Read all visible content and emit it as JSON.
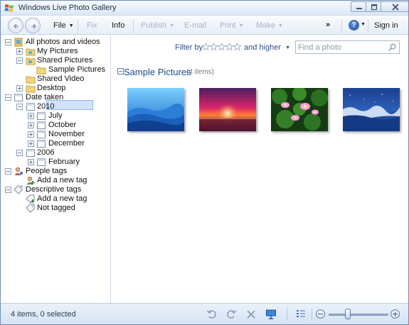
{
  "window": {
    "title": "Windows Live Photo Gallery"
  },
  "toolbar": {
    "items": [
      {
        "label": "File",
        "caret": "▼",
        "enabled": true
      },
      {
        "label": "Fix",
        "caret": "",
        "enabled": false
      },
      {
        "label": "Info",
        "caret": "",
        "enabled": true
      },
      {
        "label": "Publish",
        "caret": "▼",
        "enabled": false
      },
      {
        "label": "E-mail",
        "caret": "",
        "enabled": false
      },
      {
        "label": "Print",
        "caret": "▼",
        "enabled": false
      },
      {
        "label": "Make",
        "caret": "▼",
        "enabled": false
      }
    ],
    "overflow": "»",
    "help": "?",
    "help_caret": "▼",
    "sign_in": "Sign in"
  },
  "tree": {
    "nodes": [
      {
        "label": "All photos and videos",
        "expander": "⊟",
        "icon": "photo-library-icon"
      },
      {
        "label": "My Pictures",
        "expander": "⊞",
        "icon": "folder-icon"
      },
      {
        "label": "Shared Pictures",
        "expander": "⊟",
        "icon": "folder-icon"
      },
      {
        "label": "Sample Pictures",
        "expander": "",
        "icon": "folder-icon",
        "selected": true
      },
      {
        "label": "Shared Video",
        "expander": "",
        "icon": "folder-icon"
      },
      {
        "label": "Desktop",
        "expander": "⊞",
        "icon": "folder-icon"
      },
      {
        "label": "Date taken",
        "expander": "⊟",
        "icon": "calendar-icon"
      },
      {
        "label": "2010",
        "expander": "⊟",
        "icon": "calendar-icon"
      },
      {
        "label": "July",
        "expander": "⊞",
        "icon": "calendar-icon"
      },
      {
        "label": "October",
        "expander": "⊞",
        "icon": "calendar-icon"
      },
      {
        "label": "November",
        "expander": "⊞",
        "icon": "calendar-icon"
      },
      {
        "label": "December",
        "expander": "⊞",
        "icon": "calendar-icon"
      },
      {
        "label": "2006",
        "expander": "⊟",
        "icon": "calendar-icon"
      },
      {
        "label": "February",
        "expander": "⊞",
        "icon": "calendar-icon"
      },
      {
        "label": "People tags",
        "expander": "⊟",
        "icon": "person-tag-icon"
      },
      {
        "label": "Add a new tag",
        "expander": "",
        "icon": "add-person-tag-icon"
      },
      {
        "label": "Descriptive tags",
        "expander": "⊟",
        "icon": "tag-icon"
      },
      {
        "label": "Add a new tag",
        "expander": "",
        "icon": "add-tag-icon"
      },
      {
        "label": "Not tagged",
        "expander": "",
        "icon": "tag-icon"
      }
    ]
  },
  "main": {
    "filter_label": "Filter by",
    "rating_filter": {
      "stars": 5,
      "selected": 0
    },
    "higher_label": "and higher",
    "higher_caret": "▼",
    "search_placeholder": "Find a photo",
    "search_value": "",
    "group": {
      "toggle": "⊟",
      "title": "Sample Pictures",
      "count": "(4 items)"
    },
    "photos": [
      {
        "subject": "blue-mountain-layers"
      },
      {
        "subject": "red-sunset-over-water"
      },
      {
        "subject": "pink-water-lilies"
      },
      {
        "subject": "blue-frozen-landscape"
      }
    ]
  },
  "status": {
    "text": "4 items, 0 selected",
    "zoom_level": 0.3
  },
  "colors": {
    "accent": "#1e4a8c",
    "link": "#2d4f86",
    "selection": "#cfe3fb",
    "disabled": "#a7b2c2"
  }
}
